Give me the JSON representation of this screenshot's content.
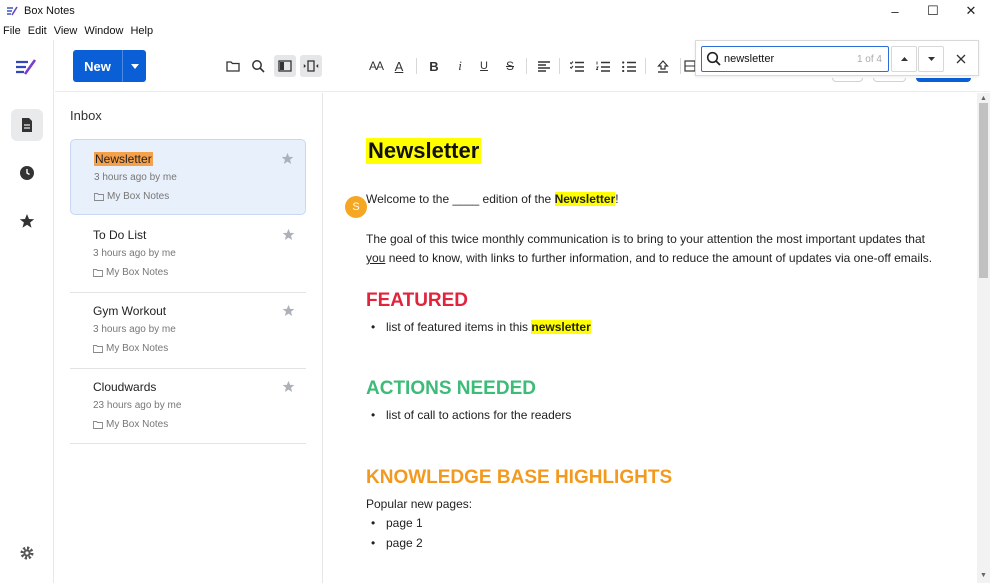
{
  "window": {
    "title": "Box Notes",
    "minimize": "–",
    "maximize": "☐",
    "close": "✕"
  },
  "menu": [
    "File",
    "Edit",
    "View",
    "Window",
    "Help"
  ],
  "toolbar": {
    "new_label": "New",
    "format_font_size": "AA",
    "format_text_color": "A",
    "format_bold": "B",
    "format_italic": "i",
    "format_underline": "U",
    "format_strike": "S"
  },
  "find": {
    "query": "newsletter",
    "count": "1 of 4"
  },
  "notelist": {
    "header": "Inbox",
    "notes": [
      {
        "title": "Newsletter",
        "meta": "3 hours ago by me",
        "folder": "My Box Notes"
      },
      {
        "title": "To Do List",
        "meta": "3 hours ago by me",
        "folder": "My Box Notes"
      },
      {
        "title": "Gym Workout",
        "meta": "3 hours ago by me",
        "folder": "My Box Notes"
      },
      {
        "title": "Cloudwards",
        "meta": "23 hours ago by me",
        "folder": "My Box Notes"
      }
    ]
  },
  "document": {
    "title": "Newsletter",
    "collaborator_initial": "S",
    "welcome_before": "Welcome to the ____ edition of the ",
    "welcome_highlight": "Newsletter",
    "welcome_after": "!",
    "goal_line1": "The goal of this twice monthly communication is to bring to your attention the most important updates that",
    "goal_line2_u": "you",
    "goal_line2_rest": " need to know, with links to further information, and to reduce the amount of updates via one-off emails.",
    "featured_heading": "FEATURED",
    "featured_item_before": "list of featured items in this ",
    "featured_item_highlight": "newsletter",
    "actions_heading": "ACTIONS NEEDED",
    "actions_item": "list of call to actions for the readers",
    "kb_heading": "KNOWLEDGE BASE HIGHLIGHTS",
    "kb_intro": "Popular new pages:",
    "kb_items": [
      "page 1",
      "page 2"
    ]
  },
  "colors": {
    "accent": "#0b5fd6",
    "featured": "#e0243c",
    "actions": "#3dbb78",
    "kb": "#f39a1e",
    "highlight": "#ffff00",
    "avatar": "#f5a623"
  }
}
